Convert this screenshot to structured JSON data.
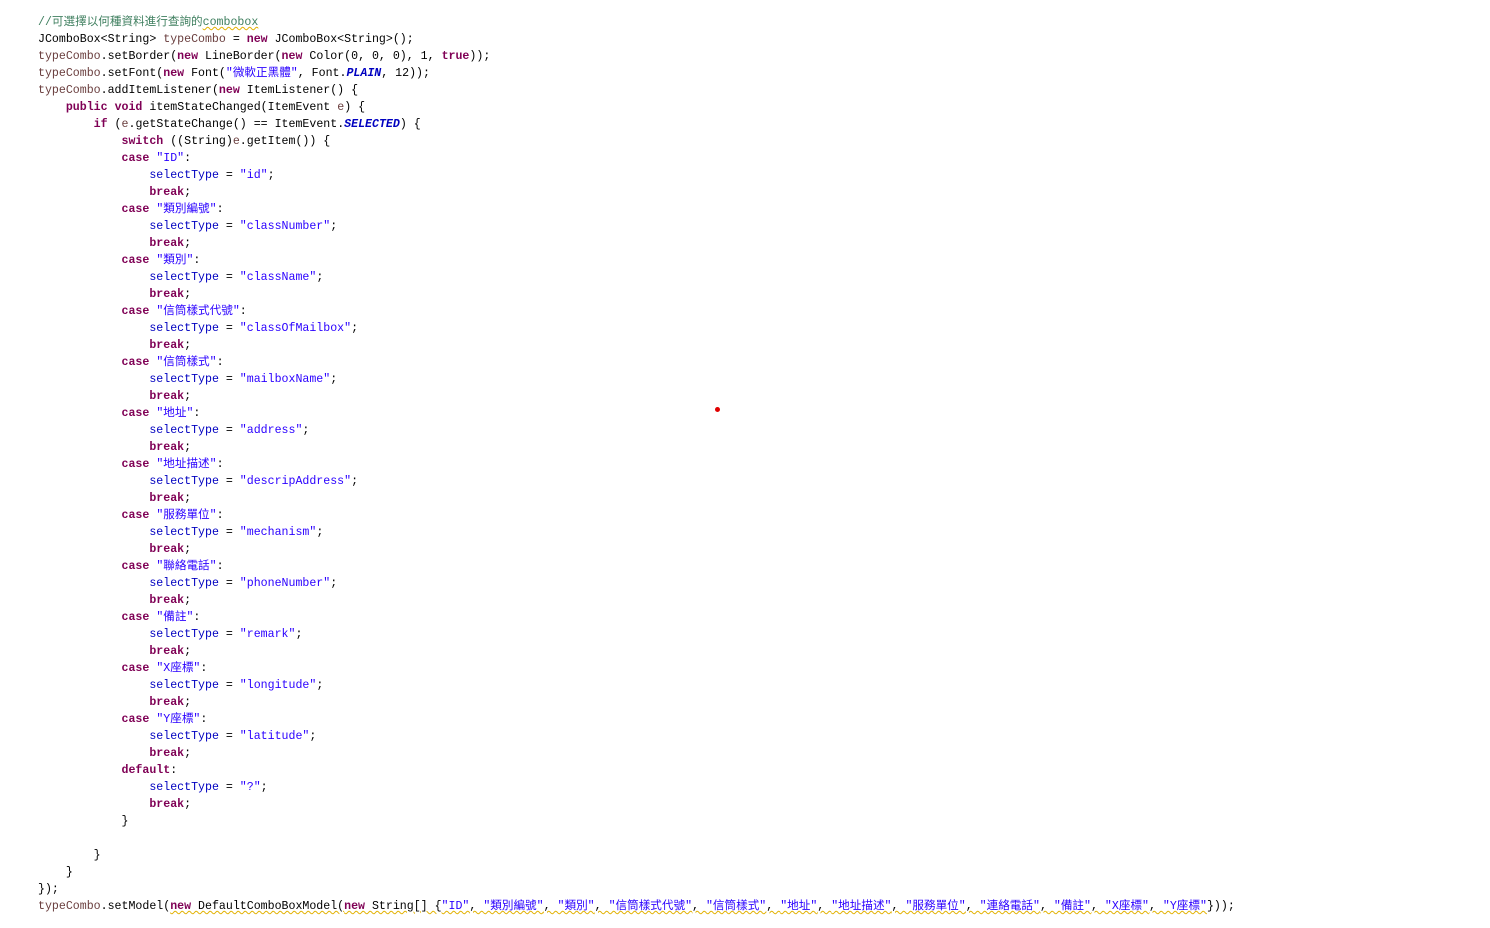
{
  "editor": {
    "lines": [
      [
        {
          "t": "//可選擇以何種資料進行查詢的",
          "k": "comment"
        },
        {
          "t": "combobox",
          "k": "comment",
          "w": true
        }
      ],
      [
        {
          "t": "JComboBox<String> ",
          "k": "plain"
        },
        {
          "t": "typeCombo",
          "k": "local"
        },
        {
          "t": " = ",
          "k": "plain"
        },
        {
          "t": "new",
          "k": "kw"
        },
        {
          "t": " JComboBox<String>();",
          "k": "plain"
        }
      ],
      [
        {
          "t": "typeCombo",
          "k": "local"
        },
        {
          "t": ".setBorder(",
          "k": "plain"
        },
        {
          "t": "new",
          "k": "kw"
        },
        {
          "t": " LineBorder(",
          "k": "plain"
        },
        {
          "t": "new",
          "k": "kw"
        },
        {
          "t": " Color(0, 0, 0), 1, ",
          "k": "plain"
        },
        {
          "t": "true",
          "k": "kw"
        },
        {
          "t": "));",
          "k": "plain"
        }
      ],
      [
        {
          "t": "typeCombo",
          "k": "local"
        },
        {
          "t": ".setFont(",
          "k": "plain"
        },
        {
          "t": "new",
          "k": "kw"
        },
        {
          "t": " Font(",
          "k": "plain"
        },
        {
          "t": "\"微軟正黑體\"",
          "k": "str"
        },
        {
          "t": ", Font.",
          "k": "plain"
        },
        {
          "t": "PLAIN",
          "k": "static"
        },
        {
          "t": ", 12));",
          "k": "plain"
        }
      ],
      [
        {
          "t": "typeCombo",
          "k": "local"
        },
        {
          "t": ".addItemListener(",
          "k": "plain"
        },
        {
          "t": "new",
          "k": "kw"
        },
        {
          "t": " ItemListener() {",
          "k": "plain"
        }
      ],
      [
        {
          "t": "    ",
          "k": "plain"
        },
        {
          "t": "public",
          "k": "kw"
        },
        {
          "t": " ",
          "k": "plain"
        },
        {
          "t": "void",
          "k": "kw"
        },
        {
          "t": " itemStateChanged(ItemEvent ",
          "k": "plain"
        },
        {
          "t": "e",
          "k": "local"
        },
        {
          "t": ") {",
          "k": "plain"
        }
      ],
      [
        {
          "t": "        ",
          "k": "plain"
        },
        {
          "t": "if",
          "k": "kw"
        },
        {
          "t": " (",
          "k": "plain"
        },
        {
          "t": "e",
          "k": "local"
        },
        {
          "t": ".getStateChange() == ItemEvent.",
          "k": "plain"
        },
        {
          "t": "SELECTED",
          "k": "static"
        },
        {
          "t": ") {",
          "k": "plain"
        }
      ],
      [
        {
          "t": "            ",
          "k": "plain"
        },
        {
          "t": "switch",
          "k": "kw"
        },
        {
          "t": " ((String)",
          "k": "plain"
        },
        {
          "t": "e",
          "k": "local"
        },
        {
          "t": ".getItem()) {",
          "k": "plain"
        }
      ],
      [
        {
          "t": "            ",
          "k": "plain"
        },
        {
          "t": "case",
          "k": "kw"
        },
        {
          "t": " ",
          "k": "plain"
        },
        {
          "t": "\"ID\"",
          "k": "str"
        },
        {
          "t": ":",
          "k": "plain"
        }
      ],
      [
        {
          "t": "                ",
          "k": "plain"
        },
        {
          "t": "selectType",
          "k": "field"
        },
        {
          "t": " = ",
          "k": "plain"
        },
        {
          "t": "\"id\"",
          "k": "str"
        },
        {
          "t": ";",
          "k": "plain"
        }
      ],
      [
        {
          "t": "                ",
          "k": "plain"
        },
        {
          "t": "break",
          "k": "kw"
        },
        {
          "t": ";",
          "k": "plain"
        }
      ],
      [
        {
          "t": "            ",
          "k": "plain"
        },
        {
          "t": "case",
          "k": "kw"
        },
        {
          "t": " ",
          "k": "plain"
        },
        {
          "t": "\"類別編號\"",
          "k": "str"
        },
        {
          "t": ":",
          "k": "plain"
        }
      ],
      [
        {
          "t": "                ",
          "k": "plain"
        },
        {
          "t": "selectType",
          "k": "field"
        },
        {
          "t": " = ",
          "k": "plain"
        },
        {
          "t": "\"classNumber\"",
          "k": "str"
        },
        {
          "t": ";",
          "k": "plain"
        }
      ],
      [
        {
          "t": "                ",
          "k": "plain"
        },
        {
          "t": "break",
          "k": "kw"
        },
        {
          "t": ";",
          "k": "plain"
        }
      ],
      [
        {
          "t": "            ",
          "k": "plain"
        },
        {
          "t": "case",
          "k": "kw"
        },
        {
          "t": " ",
          "k": "plain"
        },
        {
          "t": "\"類別\"",
          "k": "str"
        },
        {
          "t": ":",
          "k": "plain"
        }
      ],
      [
        {
          "t": "                ",
          "k": "plain"
        },
        {
          "t": "selectType",
          "k": "field"
        },
        {
          "t": " = ",
          "k": "plain"
        },
        {
          "t": "\"className\"",
          "k": "str"
        },
        {
          "t": ";",
          "k": "plain"
        }
      ],
      [
        {
          "t": "                ",
          "k": "plain"
        },
        {
          "t": "break",
          "k": "kw"
        },
        {
          "t": ";",
          "k": "plain"
        }
      ],
      [
        {
          "t": "            ",
          "k": "plain"
        },
        {
          "t": "case",
          "k": "kw"
        },
        {
          "t": " ",
          "k": "plain"
        },
        {
          "t": "\"信筒樣式代號\"",
          "k": "str"
        },
        {
          "t": ":",
          "k": "plain"
        }
      ],
      [
        {
          "t": "                ",
          "k": "plain"
        },
        {
          "t": "selectType",
          "k": "field"
        },
        {
          "t": " = ",
          "k": "plain"
        },
        {
          "t": "\"classOfMailbox\"",
          "k": "str"
        },
        {
          "t": ";",
          "k": "plain"
        }
      ],
      [
        {
          "t": "                ",
          "k": "plain"
        },
        {
          "t": "break",
          "k": "kw"
        },
        {
          "t": ";",
          "k": "plain"
        }
      ],
      [
        {
          "t": "            ",
          "k": "plain"
        },
        {
          "t": "case",
          "k": "kw"
        },
        {
          "t": " ",
          "k": "plain"
        },
        {
          "t": "\"信筒樣式\"",
          "k": "str"
        },
        {
          "t": ":",
          "k": "plain"
        }
      ],
      [
        {
          "t": "                ",
          "k": "plain"
        },
        {
          "t": "selectType",
          "k": "field"
        },
        {
          "t": " = ",
          "k": "plain"
        },
        {
          "t": "\"mailboxName\"",
          "k": "str"
        },
        {
          "t": ";",
          "k": "plain"
        }
      ],
      [
        {
          "t": "                ",
          "k": "plain"
        },
        {
          "t": "break",
          "k": "kw"
        },
        {
          "t": ";",
          "k": "plain"
        }
      ],
      [
        {
          "t": "            ",
          "k": "plain"
        },
        {
          "t": "case",
          "k": "kw"
        },
        {
          "t": " ",
          "k": "plain"
        },
        {
          "t": "\"地址\"",
          "k": "str"
        },
        {
          "t": ":",
          "k": "plain"
        }
      ],
      [
        {
          "t": "                ",
          "k": "plain"
        },
        {
          "t": "selectType",
          "k": "field"
        },
        {
          "t": " = ",
          "k": "plain"
        },
        {
          "t": "\"address\"",
          "k": "str"
        },
        {
          "t": ";",
          "k": "plain"
        }
      ],
      [
        {
          "t": "                ",
          "k": "plain"
        },
        {
          "t": "break",
          "k": "kw"
        },
        {
          "t": ";",
          "k": "plain"
        }
      ],
      [
        {
          "t": "            ",
          "k": "plain"
        },
        {
          "t": "case",
          "k": "kw"
        },
        {
          "t": " ",
          "k": "plain"
        },
        {
          "t": "\"地址描述\"",
          "k": "str"
        },
        {
          "t": ":",
          "k": "plain"
        }
      ],
      [
        {
          "t": "                ",
          "k": "plain"
        },
        {
          "t": "selectType",
          "k": "field"
        },
        {
          "t": " = ",
          "k": "plain"
        },
        {
          "t": "\"descripAddress\"",
          "k": "str"
        },
        {
          "t": ";",
          "k": "plain"
        }
      ],
      [
        {
          "t": "                ",
          "k": "plain"
        },
        {
          "t": "break",
          "k": "kw"
        },
        {
          "t": ";",
          "k": "plain"
        }
      ],
      [
        {
          "t": "            ",
          "k": "plain"
        },
        {
          "t": "case",
          "k": "kw"
        },
        {
          "t": " ",
          "k": "plain"
        },
        {
          "t": "\"服務單位\"",
          "k": "str"
        },
        {
          "t": ":",
          "k": "plain"
        }
      ],
      [
        {
          "t": "                ",
          "k": "plain"
        },
        {
          "t": "selectType",
          "k": "field"
        },
        {
          "t": " = ",
          "k": "plain"
        },
        {
          "t": "\"mechanism\"",
          "k": "str"
        },
        {
          "t": ";",
          "k": "plain"
        }
      ],
      [
        {
          "t": "                ",
          "k": "plain"
        },
        {
          "t": "break",
          "k": "kw"
        },
        {
          "t": ";",
          "k": "plain"
        }
      ],
      [
        {
          "t": "            ",
          "k": "plain"
        },
        {
          "t": "case",
          "k": "kw"
        },
        {
          "t": " ",
          "k": "plain"
        },
        {
          "t": "\"聯絡電話\"",
          "k": "str"
        },
        {
          "t": ":",
          "k": "plain"
        }
      ],
      [
        {
          "t": "                ",
          "k": "plain"
        },
        {
          "t": "selectType",
          "k": "field"
        },
        {
          "t": " = ",
          "k": "plain"
        },
        {
          "t": "\"phoneNumber\"",
          "k": "str"
        },
        {
          "t": ";",
          "k": "plain"
        }
      ],
      [
        {
          "t": "                ",
          "k": "plain"
        },
        {
          "t": "break",
          "k": "kw"
        },
        {
          "t": ";",
          "k": "plain"
        }
      ],
      [
        {
          "t": "            ",
          "k": "plain"
        },
        {
          "t": "case",
          "k": "kw"
        },
        {
          "t": " ",
          "k": "plain"
        },
        {
          "t": "\"備註\"",
          "k": "str"
        },
        {
          "t": ":",
          "k": "plain"
        }
      ],
      [
        {
          "t": "                ",
          "k": "plain"
        },
        {
          "t": "selectType",
          "k": "field"
        },
        {
          "t": " = ",
          "k": "plain"
        },
        {
          "t": "\"remark\"",
          "k": "str"
        },
        {
          "t": ";",
          "k": "plain"
        }
      ],
      [
        {
          "t": "                ",
          "k": "plain"
        },
        {
          "t": "break",
          "k": "kw"
        },
        {
          "t": ";",
          "k": "plain"
        }
      ],
      [
        {
          "t": "            ",
          "k": "plain"
        },
        {
          "t": "case",
          "k": "kw"
        },
        {
          "t": " ",
          "k": "plain"
        },
        {
          "t": "\"X座標\"",
          "k": "str"
        },
        {
          "t": ":",
          "k": "plain"
        }
      ],
      [
        {
          "t": "                ",
          "k": "plain"
        },
        {
          "t": "selectType",
          "k": "field"
        },
        {
          "t": " = ",
          "k": "plain"
        },
        {
          "t": "\"longitude\"",
          "k": "str"
        },
        {
          "t": ";",
          "k": "plain"
        }
      ],
      [
        {
          "t": "                ",
          "k": "plain"
        },
        {
          "t": "break",
          "k": "kw"
        },
        {
          "t": ";",
          "k": "plain"
        }
      ],
      [
        {
          "t": "            ",
          "k": "plain"
        },
        {
          "t": "case",
          "k": "kw"
        },
        {
          "t": " ",
          "k": "plain"
        },
        {
          "t": "\"Y座標\"",
          "k": "str"
        },
        {
          "t": ":",
          "k": "plain"
        }
      ],
      [
        {
          "t": "                ",
          "k": "plain"
        },
        {
          "t": "selectType",
          "k": "field"
        },
        {
          "t": " = ",
          "k": "plain"
        },
        {
          "t": "\"latitude\"",
          "k": "str"
        },
        {
          "t": ";",
          "k": "plain"
        }
      ],
      [
        {
          "t": "                ",
          "k": "plain"
        },
        {
          "t": "break",
          "k": "kw"
        },
        {
          "t": ";",
          "k": "plain"
        }
      ],
      [
        {
          "t": "            ",
          "k": "plain"
        },
        {
          "t": "default",
          "k": "kw"
        },
        {
          "t": ":",
          "k": "plain"
        }
      ],
      [
        {
          "t": "                ",
          "k": "plain"
        },
        {
          "t": "selectType",
          "k": "field"
        },
        {
          "t": " = ",
          "k": "plain"
        },
        {
          "t": "\"?\"",
          "k": "str"
        },
        {
          "t": ";",
          "k": "plain"
        }
      ],
      [
        {
          "t": "                ",
          "k": "plain"
        },
        {
          "t": "break",
          "k": "kw"
        },
        {
          "t": ";",
          "k": "plain"
        }
      ],
      [
        {
          "t": "            }",
          "k": "plain"
        }
      ],
      [
        {
          "t": "",
          "k": "plain"
        }
      ],
      [
        {
          "t": "        }",
          "k": "plain"
        }
      ],
      [
        {
          "t": "    }",
          "k": "plain"
        }
      ],
      [
        {
          "t": "});",
          "k": "plain"
        }
      ],
      [
        {
          "t": "typeCombo",
          "k": "local"
        },
        {
          "t": ".setModel(",
          "k": "plain"
        },
        {
          "t": "new",
          "k": "kw",
          "w": true
        },
        {
          "t": " DefaultComboBoxModel(",
          "k": "plain",
          "w": true
        },
        {
          "t": "new",
          "k": "kw",
          "w": true
        },
        {
          "t": " String[] {",
          "k": "plain",
          "w": true
        },
        {
          "t": "\"ID\"",
          "k": "str",
          "w": true
        },
        {
          "t": ", ",
          "k": "plain",
          "w": true
        },
        {
          "t": "\"類別編號\"",
          "k": "str",
          "w": true
        },
        {
          "t": ", ",
          "k": "plain",
          "w": true
        },
        {
          "t": "\"類別\"",
          "k": "str",
          "w": true
        },
        {
          "t": ", ",
          "k": "plain",
          "w": true
        },
        {
          "t": "\"信筒樣式代號\"",
          "k": "str",
          "w": true
        },
        {
          "t": ", ",
          "k": "plain",
          "w": true
        },
        {
          "t": "\"信筒樣式\"",
          "k": "str",
          "w": true
        },
        {
          "t": ", ",
          "k": "plain",
          "w": true
        },
        {
          "t": "\"地址\"",
          "k": "str",
          "w": true
        },
        {
          "t": ", ",
          "k": "plain",
          "w": true
        },
        {
          "t": "\"地址描述\"",
          "k": "str",
          "w": true
        },
        {
          "t": ", ",
          "k": "plain",
          "w": true
        },
        {
          "t": "\"服務單位\"",
          "k": "str",
          "w": true
        },
        {
          "t": ", ",
          "k": "plain",
          "w": true
        },
        {
          "t": "\"連絡電話\"",
          "k": "str",
          "w": true
        },
        {
          "t": ", ",
          "k": "plain",
          "w": true
        },
        {
          "t": "\"備註\"",
          "k": "str",
          "w": true
        },
        {
          "t": ", ",
          "k": "plain",
          "w": true
        },
        {
          "t": "\"X座標\"",
          "k": "str",
          "w": true
        },
        {
          "t": ", ",
          "k": "plain",
          "w": true
        },
        {
          "t": "\"Y座標\"",
          "k": "str",
          "w": true
        },
        {
          "t": "}));",
          "k": "plain"
        }
      ]
    ],
    "colors": {
      "keyword": "#7f0055",
      "string": "#2a00ff",
      "field": "#0000c0",
      "local": "#6a3e3e",
      "comment": "#3f7f5f",
      "warning_underline": "#e2b100",
      "marker": "#e00000"
    }
  }
}
